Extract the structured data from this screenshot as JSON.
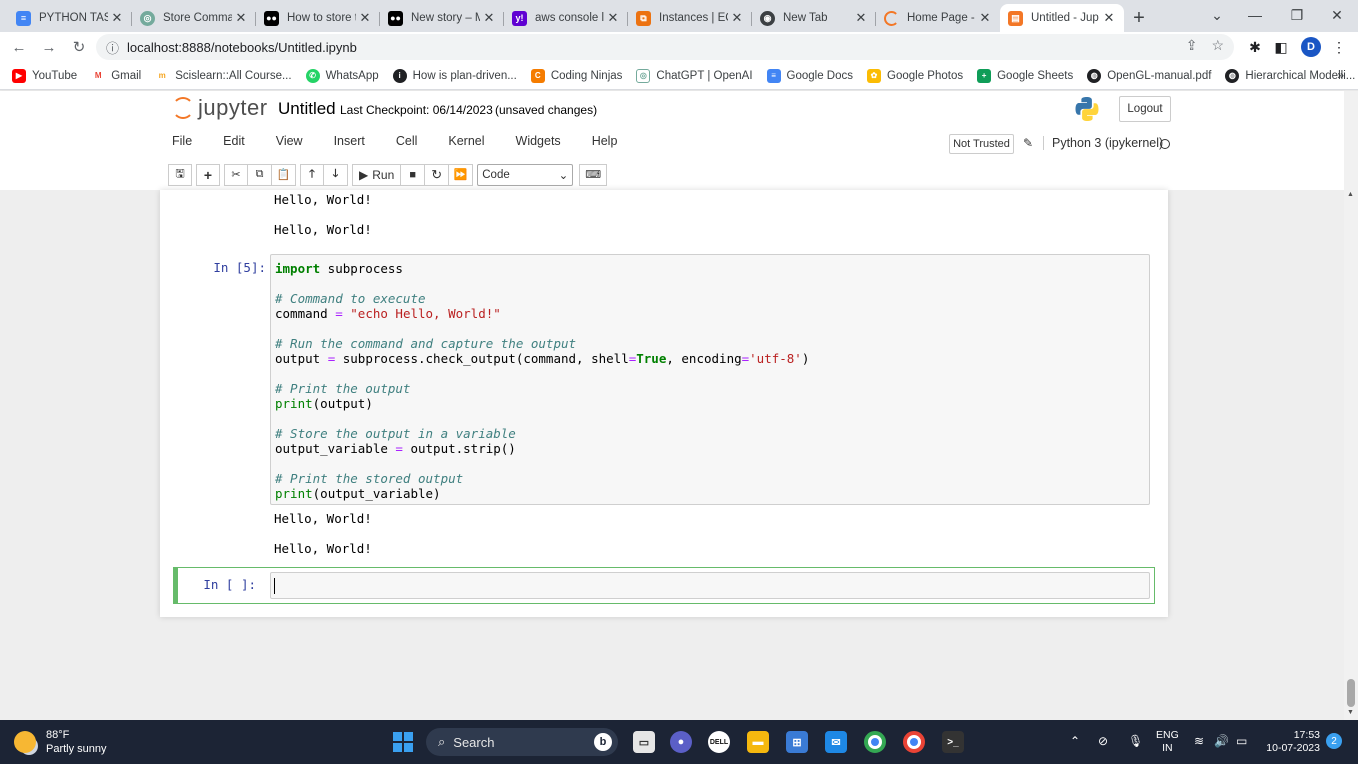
{
  "browser": {
    "tabs": [
      {
        "title": "PYTHON TASK",
        "favicon": "google-docs-icon",
        "color": "#4285f4"
      },
      {
        "title": "Store Comman",
        "favicon": "chatgpt-icon",
        "color": "#74aa9c"
      },
      {
        "title": "How to store t",
        "favicon": "medium-icon",
        "color": "#000000"
      },
      {
        "title": "New story – M",
        "favicon": "medium-icon",
        "color": "#000000"
      },
      {
        "title": "aws console lo",
        "favicon": "yahoo-icon",
        "color": "#6001d2"
      },
      {
        "title": "Instances | EC",
        "favicon": "aws-icon",
        "color": "#ec7211"
      },
      {
        "title": "New Tab",
        "favicon": "chrome-icon",
        "color": "#3c4043"
      },
      {
        "title": "Home Page - ",
        "favicon": "loading-icon",
        "color": "#f37726"
      },
      {
        "title": "Untitled - Jup",
        "favicon": "jupyter-icon",
        "color": "#f37726"
      }
    ],
    "url": "localhost:8888/notebooks/Untitled.ipynb",
    "bookmarks": [
      {
        "label": "YouTube",
        "color": "#ff0000"
      },
      {
        "label": "Gmail",
        "color": "#ea4335"
      },
      {
        "label": "Scislearn::All Course...",
        "color": "#f5a623"
      },
      {
        "label": "WhatsApp",
        "color": "#25d366"
      },
      {
        "label": "How is plan-driven...",
        "color": "#202124"
      },
      {
        "label": "Coding Ninjas",
        "color": "#f57c00"
      },
      {
        "label": "ChatGPT | OpenAI",
        "color": "#74aa9c"
      },
      {
        "label": "Google Docs",
        "color": "#4285f4"
      },
      {
        "label": "Google Photos",
        "color": "#fbbc04"
      },
      {
        "label": "Google Sheets",
        "color": "#0f9d58"
      },
      {
        "label": "OpenGL-manual.pdf",
        "color": "#202124"
      },
      {
        "label": "Hierarchical Modelli...",
        "color": "#202124"
      }
    ],
    "profile_initial": "D"
  },
  "jupyter": {
    "logo_text": "jupyter",
    "notebook_title": "Untitled",
    "checkpoint": "Last Checkpoint: 06/14/2023",
    "unsaved": "(unsaved changes)",
    "logout": "Logout",
    "menu": [
      "File",
      "Edit",
      "View",
      "Insert",
      "Cell",
      "Kernel",
      "Widgets",
      "Help"
    ],
    "not_trusted": "Not Trusted",
    "kernel": "Python 3 (ipykernel)",
    "run_label": "Run",
    "cell_type": "Code"
  },
  "notebook": {
    "outputs_top": [
      "Hello, World!",
      "Hello, World!"
    ],
    "cell5_prompt": "In [5]:",
    "code": {
      "l1_kw": "import",
      "l1_rest": " subprocess",
      "c1": "# Command to execute",
      "l2_a": "command ",
      "l2_op": "=",
      "l2_str": " \"echo Hello, World!\"",
      "c2": "# Run the command and capture the output",
      "l3_a": "output ",
      "l3_op": "=",
      "l3_b": " subprocess.check_output(command, shell",
      "l3_op2": "=",
      "l3_true": "True",
      "l3_c": ", encoding",
      "l3_op3": "=",
      "l3_str": "'utf-8'",
      "l3_d": ")",
      "c3": "# Print the output",
      "l4_fn": "print",
      "l4_rest": "(output)",
      "c4": "# Store the output in a variable",
      "l5_a": "output_variable ",
      "l5_op": "=",
      "l5_b": " output.strip()",
      "c5": "# Print the stored output",
      "l6_fn": "print",
      "l6_rest": "(output_variable)"
    },
    "outputs_bottom": [
      "Hello, World!",
      "Hello, World!"
    ],
    "new_prompt": "In [ ]:"
  },
  "taskbar": {
    "temp": "88°F",
    "weather": "Partly sunny",
    "search": "Search",
    "lang1": "ENG",
    "lang2": "IN",
    "time": "17:53",
    "date": "10-07-2023",
    "notifications": "2"
  }
}
